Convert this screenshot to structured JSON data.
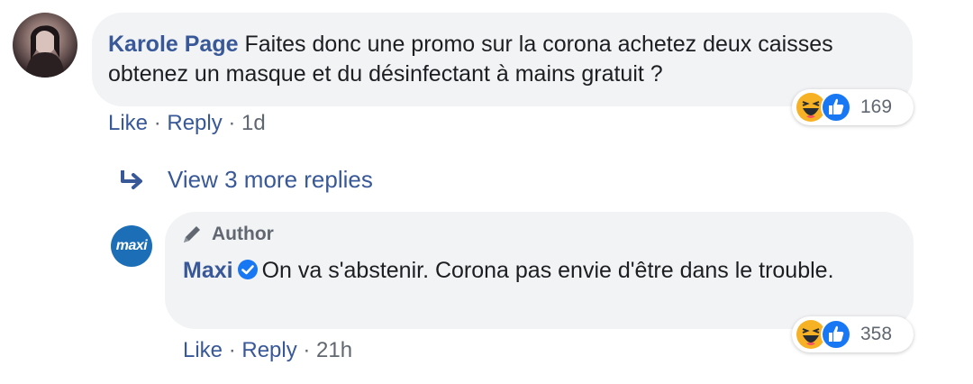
{
  "comment": {
    "author": "Karole Page",
    "text": "Faites donc une promo sur la corona achetez deux caisses obtenez un masque et du désinfectant à mains gratuit ?",
    "actions": {
      "like": "Like",
      "reply": "Reply",
      "sep": " · ",
      "time": "1d"
    },
    "reaction_count": "169"
  },
  "view_more": {
    "label": "View 3 more replies"
  },
  "reply": {
    "badge": "Author",
    "author": "Maxi",
    "avatar_text": "maxi",
    "text": "On va s'abstenir. Corona pas envie d'être dans le trouble.",
    "actions": {
      "like": "Like",
      "reply": "Reply",
      "sep": " · ",
      "time": "21h"
    },
    "reaction_count": "358"
  },
  "colors": {
    "link": "#385898",
    "bubble": "#f2f3f5",
    "meta": "#606770",
    "verified": "#1877f2",
    "haha": "#f7b125",
    "like": "#1877f2"
  }
}
